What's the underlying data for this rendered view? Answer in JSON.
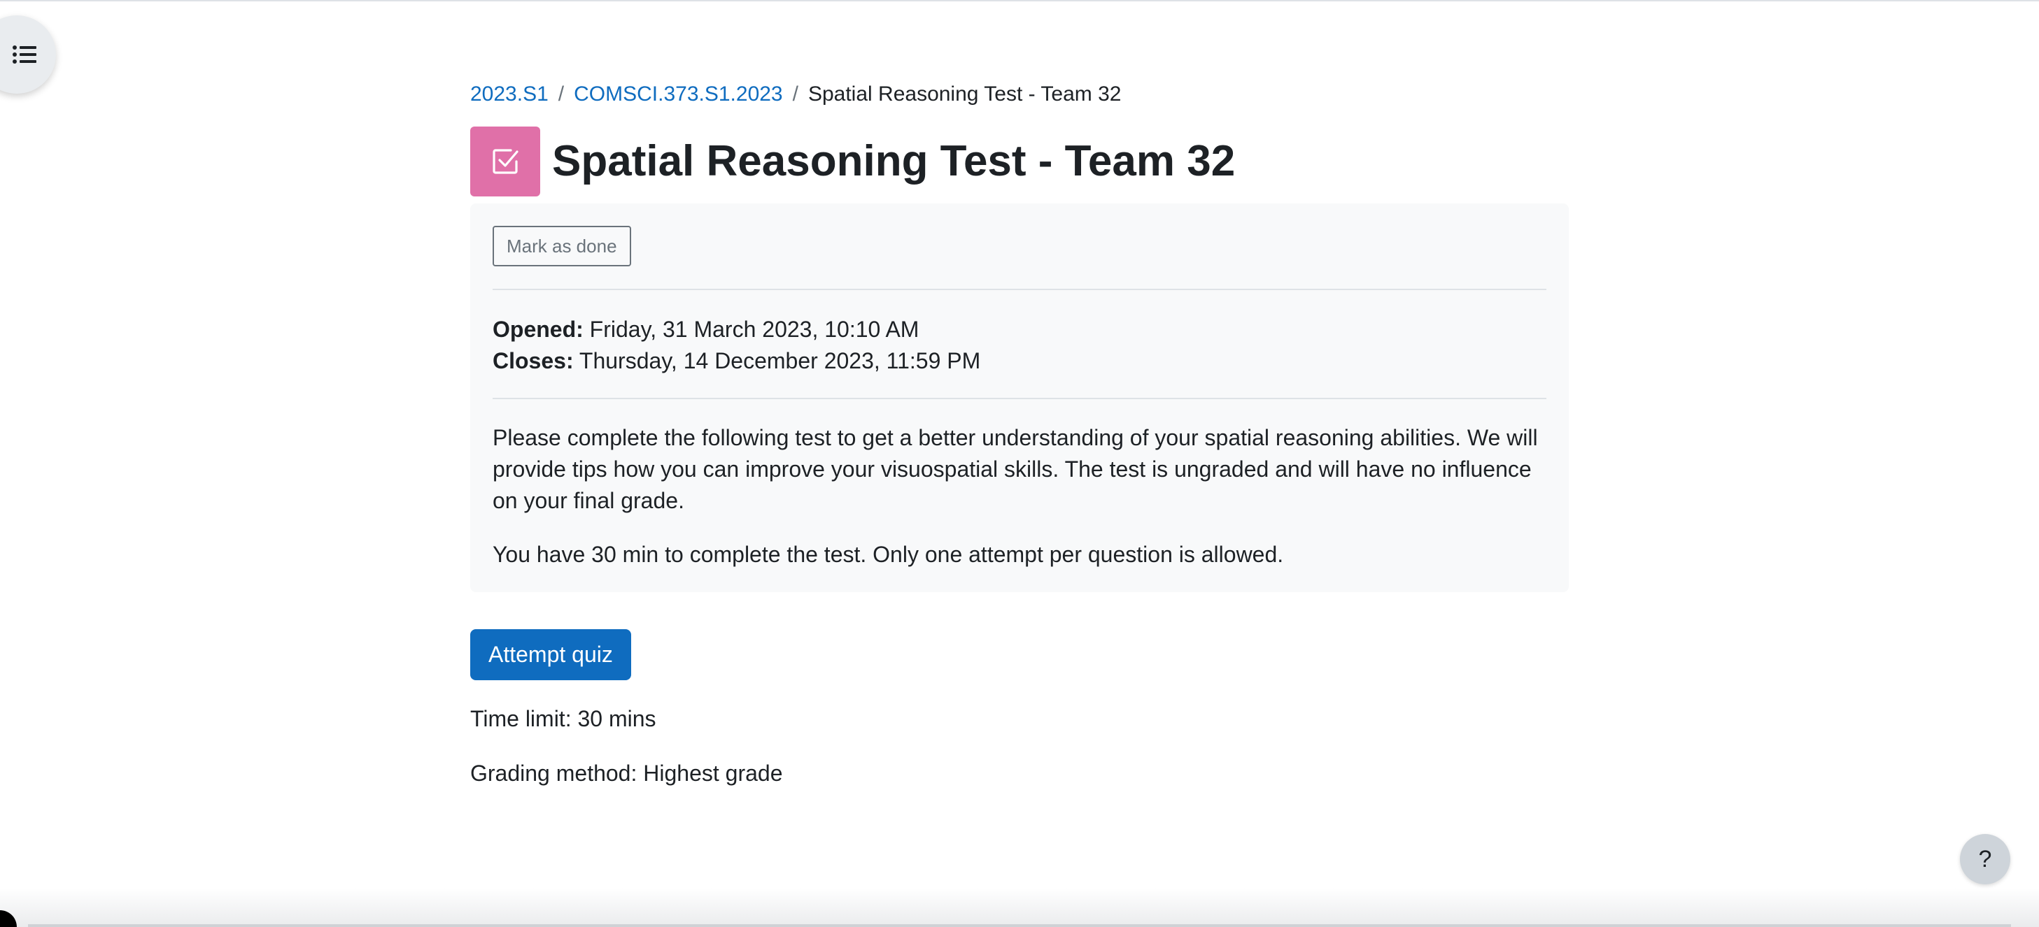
{
  "drawer": {
    "icon": "list-icon"
  },
  "breadcrumb": {
    "items": [
      {
        "label": "2023.S1"
      },
      {
        "label": "COMSCI.373.S1.2023"
      }
    ],
    "separator": "/",
    "current": "Spatial Reasoning Test - Team 32"
  },
  "header": {
    "icon": "quiz-checkbox-icon",
    "icon_color": "#e070a8",
    "title": "Spatial Reasoning Test - Team 32"
  },
  "completion": {
    "button_label": "Mark as done"
  },
  "dates": {
    "opened_label": "Opened:",
    "opened_value": "Friday, 31 March 2023, 10:10 AM",
    "closes_label": "Closes:",
    "closes_value": "Thursday, 14 December 2023, 11:59 PM"
  },
  "description": {
    "paragraph1": "Please complete the following test to get a better understanding of your spatial reasoning abilities. We will provide tips how you can improve your visuospatial skills. The test is ungraded and will have no influence on your final grade.",
    "paragraph2": "You have 30 min to complete the test. Only one attempt per question is allowed."
  },
  "actions": {
    "attempt_label": "Attempt quiz",
    "accent": "#0f6cbf"
  },
  "quiz_info": {
    "time_limit": "Time limit: 30 mins",
    "grading_method": "Grading method: Highest grade"
  },
  "help": {
    "label": "?"
  }
}
